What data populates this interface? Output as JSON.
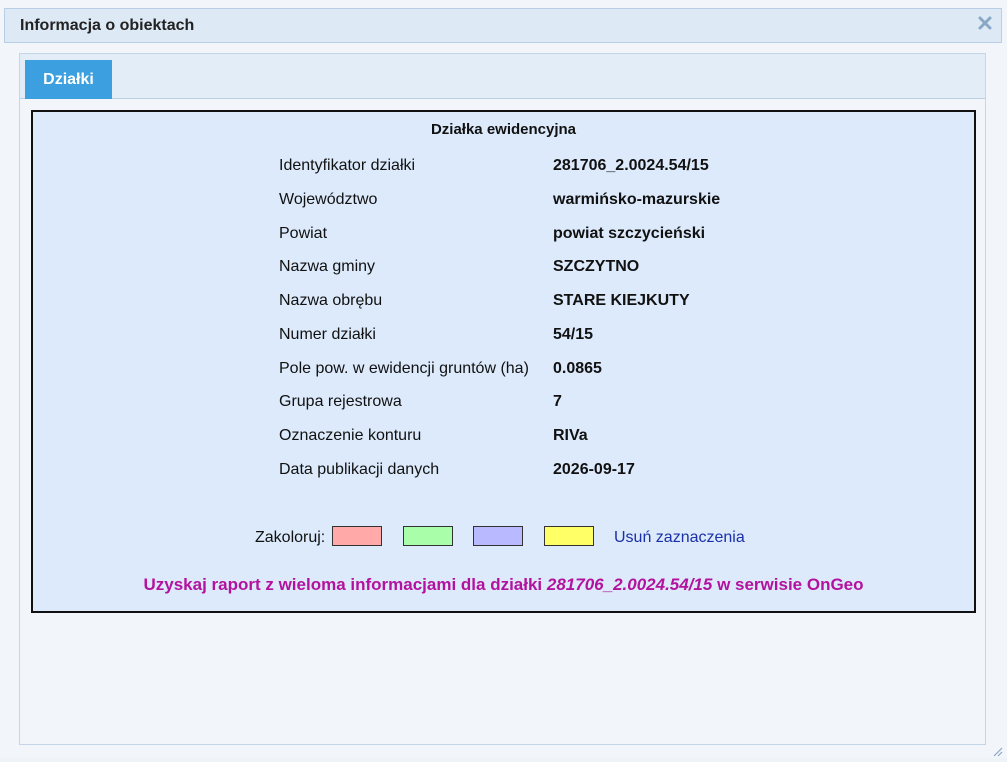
{
  "dialog": {
    "title": "Informacja o obiektach",
    "close_icon": "close-icon"
  },
  "tabs": [
    {
      "label": "Działki",
      "active": true
    }
  ],
  "parcel": {
    "heading": "Działka ewidencyjna",
    "rows": [
      {
        "label": "Identyfikator działki",
        "value": "281706_2.0024.54/15"
      },
      {
        "label": "Województwo",
        "value": "warmińsko-mazurskie"
      },
      {
        "label": "Powiat",
        "value": "powiat szczycieński"
      },
      {
        "label": "Nazwa gminy",
        "value": "SZCZYTNO"
      },
      {
        "label": "Nazwa obrębu",
        "value": "STARE KIEJKUTY"
      },
      {
        "label": "Numer działki",
        "value": "54/15"
      },
      {
        "label": "Pole pow. w ewidencji gruntów (ha)",
        "value": "0.0865"
      },
      {
        "label": "Grupa rejestrowa",
        "value": "7"
      },
      {
        "label": "Oznaczenie konturu",
        "value": "RIVa"
      },
      {
        "label": "Data publikacji danych",
        "value": "2026-09-17"
      }
    ]
  },
  "colorize": {
    "label": "Zakoloruj:",
    "swatches": [
      {
        "name": "red",
        "color": "#ffa9a9"
      },
      {
        "name": "green",
        "color": "#a9ffa9"
      },
      {
        "name": "blue",
        "color": "#b9b9ff"
      },
      {
        "name": "yellow",
        "color": "#ffff66"
      }
    ],
    "clear_label": "Usuń zaznaczenia"
  },
  "report": {
    "prefix": "Uzyskaj raport z wieloma informacjami dla działki ",
    "parcel_id": "281706_2.0024.54/15",
    "suffix": " w serwisie OnGeo"
  },
  "colors": {
    "tab_active": "#3c9fdf",
    "panel_bg": "#dceafb",
    "report_text": "#b3129e",
    "link": "#1a2fa8"
  }
}
